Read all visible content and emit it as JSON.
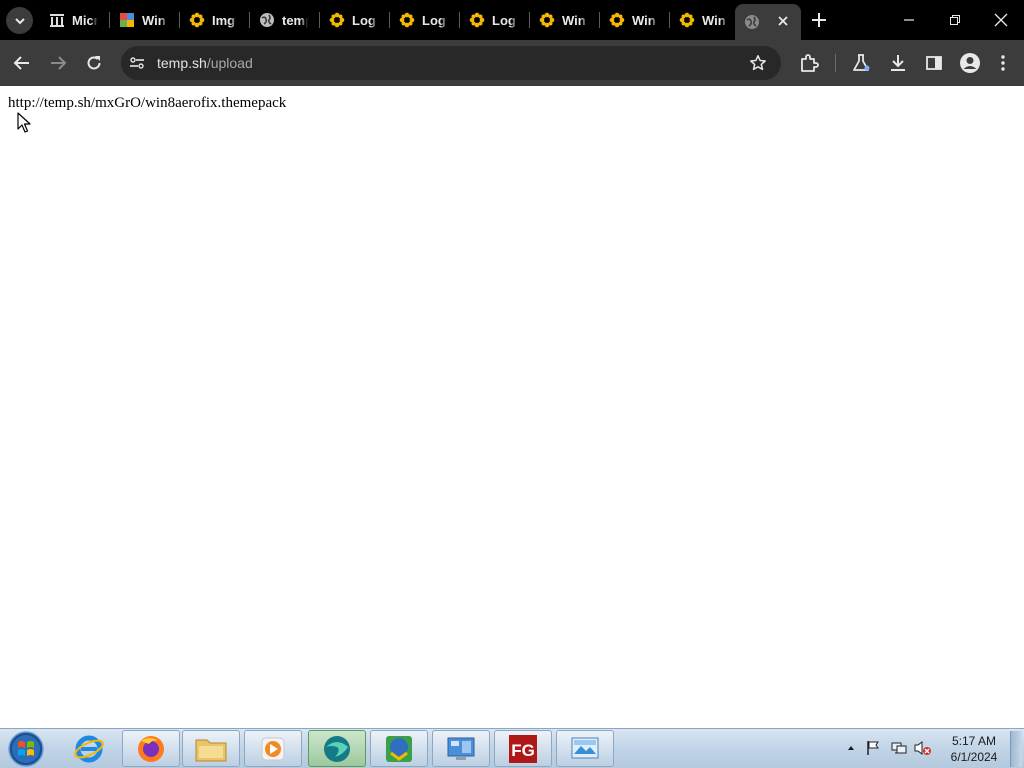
{
  "tabs": [
    {
      "title": "Micr",
      "icon": "columns-icon"
    },
    {
      "title": "Win",
      "icon": "colorful-grid-icon"
    },
    {
      "title": "Img",
      "icon": "flower-icon"
    },
    {
      "title": "temp",
      "icon": "globe-icon"
    },
    {
      "title": "Log",
      "icon": "flower-icon"
    },
    {
      "title": "Log",
      "icon": "flower-icon"
    },
    {
      "title": "Log",
      "icon": "flower-icon"
    },
    {
      "title": "Win",
      "icon": "flower-icon"
    },
    {
      "title": "Win",
      "icon": "flower-icon"
    },
    {
      "title": "Win",
      "icon": "flower-icon"
    }
  ],
  "active_tab": {
    "icon": "globe-icon"
  },
  "address_bar": {
    "host": "temp.sh",
    "path": "/upload"
  },
  "page": {
    "text": "http://temp.sh/mxGrO/win8aerofix.themepack"
  },
  "taskbar": {
    "pinned": [
      "internet-explorer-icon",
      "firefox-icon",
      "file-explorer-icon",
      "media-player-icon",
      "browser-icon",
      "download-manager-icon",
      "control-panel-icon",
      "fg-app-icon",
      "photo-viewer-icon"
    ],
    "clock": {
      "time": "5:17 AM",
      "date": "6/1/2024"
    }
  },
  "colors": {
    "flower": "#f5b800",
    "chrome_dark": "#3c3c3c",
    "tab_strip": "#000000"
  }
}
